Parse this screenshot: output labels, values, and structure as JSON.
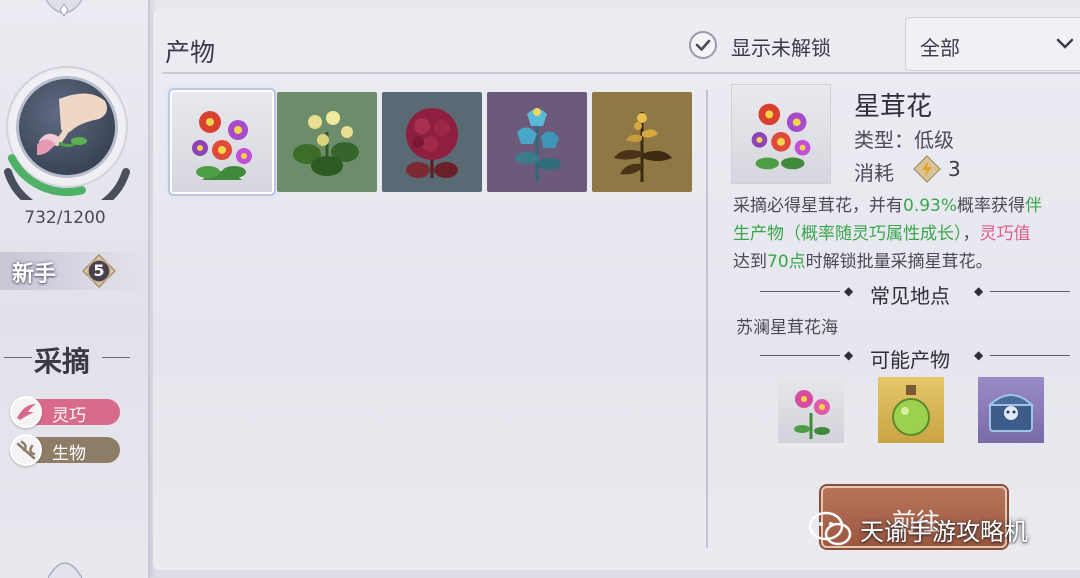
{
  "sidebar": {
    "xp": "732/1200",
    "xp_progress": 0.61,
    "rank_label": "新手",
    "rank_level": "5",
    "section_title": "采摘",
    "tags": [
      {
        "label": "灵巧",
        "icon": "dexterity-icon",
        "color": "#d86b8b"
      },
      {
        "label": "生物",
        "icon": "creature-icon",
        "color": "#8e7d66"
      }
    ]
  },
  "header": {
    "title": "产物",
    "show_locked_label": "显示未解锁",
    "show_locked_checked": true,
    "filter_value": "全部"
  },
  "products": [
    {
      "name": "red-purple-flower-bush",
      "selected": true
    },
    {
      "name": "yellow-flower-plant",
      "selected": false
    },
    {
      "name": "crimson-hydrangea",
      "selected": false
    },
    {
      "name": "blue-bell-flower",
      "selected": false
    },
    {
      "name": "golden-leaf-plant",
      "selected": false
    }
  ],
  "detail": {
    "name": "星茸花",
    "type_line": "类型：低级",
    "cost_label": "消耗",
    "cost_value": "3",
    "desc": {
      "l1a": "采摘必得星茸花，并有",
      "l1b": "0.93%",
      "l1c": "概率获得",
      "l1d": "伴",
      "l2a": "生产物（概率随灵巧属性成长）",
      "l2b": "，",
      "l2c": "灵巧值",
      "l3a": "达到",
      "l3b": "70点",
      "l3c": "时解锁批量采摘星茸花。"
    },
    "locations_title": "常见地点",
    "location": "苏澜星茸花海",
    "outputs_title": "可能产物",
    "outputs": [
      "flower-item",
      "potion-item",
      "treasure-chest-item"
    ],
    "go_button": "前往"
  },
  "watermark": "天谕手游攻略机",
  "colors": {
    "green_text": "#3aa64a",
    "pink_text": "#e25b8c",
    "button": "#a8644a"
  }
}
